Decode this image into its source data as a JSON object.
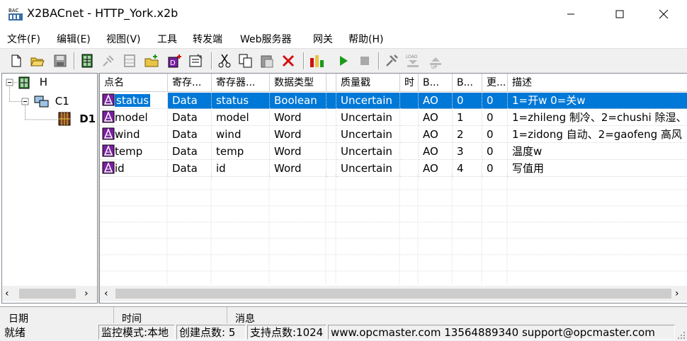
{
  "window": {
    "title": "X2BACnet - HTTP_York.x2b"
  },
  "menu": [
    "文件(F)",
    "编辑(E)",
    "视图(V)",
    "工具",
    "转发端",
    "Web服务器",
    "网关",
    "帮助(H)"
  ],
  "toolbar": {
    "icons": [
      "new-file-icon",
      "open-folder-icon",
      "save-icon",
      "device-icon",
      "disabled-plug-icon",
      "disabled-grid-icon",
      "add-folder-icon",
      "add-point-icon",
      "properties-icon",
      "cut-icon",
      "copy-icon",
      "paste-icon",
      "delete-icon",
      "monitor-icon",
      "run-icon",
      "stop-icon",
      "tools-icon",
      "load-icon",
      "up-icon"
    ]
  },
  "tree": {
    "root": "H",
    "channel": "C1",
    "device": "D1"
  },
  "grid": {
    "columns": [
      "点名",
      "寄存...",
      "寄存器...",
      "数据类型",
      "",
      "质量戳",
      "时",
      "B...",
      "B...",
      "更...",
      "描述"
    ],
    "rows": [
      [
        "status",
        "Data",
        "status",
        "Boolean",
        "",
        "Uncertain",
        "",
        "AO",
        "0",
        "0",
        "1=开w 0=关w"
      ],
      [
        "model",
        "Data",
        "model",
        "Word",
        "",
        "Uncertain",
        "",
        "AO",
        "1",
        "0",
        "1=zhileng 制冷、2=chushi 除湿、"
      ],
      [
        "wind",
        "Data",
        "wind",
        "Word",
        "",
        "Uncertain",
        "",
        "AO",
        "2",
        "0",
        "1=zidong 自动、2=gaofeng 高风"
      ],
      [
        "temp",
        "Data",
        "temp",
        "Word",
        "",
        "Uncertain",
        "",
        "AO",
        "3",
        "0",
        "温度w"
      ],
      [
        "id",
        "Data",
        "id",
        "Word",
        "",
        "Uncertain",
        "",
        "AO",
        "4",
        "0",
        "写值用"
      ]
    ]
  },
  "log": {
    "columns": [
      "日期",
      "时间",
      "消息"
    ]
  },
  "status": {
    "ready": "就绪",
    "mode": "监控模式:本地",
    "created": "创建点数: 5",
    "supported": "支持点数:1024",
    "contact": "www.opcmaster.com 13564889340 support@opcmaster.com"
  },
  "colors": {
    "selection": "#0078d7",
    "run": "#1a9a1a",
    "delete": "#d01010"
  }
}
